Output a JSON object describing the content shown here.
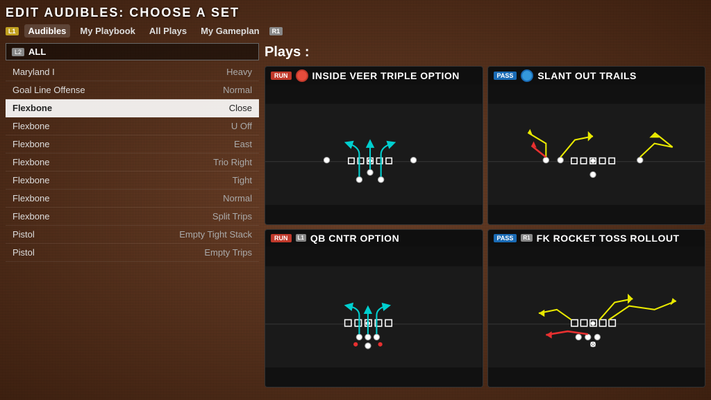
{
  "page": {
    "title": "EDIT AUDIBLES: CHOOSE A SET"
  },
  "tabs": {
    "l1_badge": "L1",
    "r1_badge": "R1",
    "items": [
      {
        "label": "Audibles",
        "active": true
      },
      {
        "label": "My Playbook",
        "active": false
      },
      {
        "label": "All Plays",
        "active": false
      },
      {
        "label": "My Gameplan",
        "active": false
      }
    ]
  },
  "filter": {
    "badge": "L2",
    "value": "ALL"
  },
  "plays_label": "Plays :",
  "formations": [
    {
      "name": "Maryland I",
      "variant": "Heavy",
      "selected": false
    },
    {
      "name": "Goal Line Offense",
      "variant": "Normal",
      "selected": false
    },
    {
      "name": "Flexbone",
      "variant": "Close",
      "selected": true
    },
    {
      "name": "Flexbone",
      "variant": "U Off",
      "selected": false
    },
    {
      "name": "Flexbone",
      "variant": "East",
      "selected": false
    },
    {
      "name": "Flexbone",
      "variant": "Trio Right",
      "selected": false
    },
    {
      "name": "Flexbone",
      "variant": "Tight",
      "selected": false
    },
    {
      "name": "Flexbone",
      "variant": "Normal",
      "selected": false
    },
    {
      "name": "Flexbone",
      "variant": "Split Trips",
      "selected": false
    },
    {
      "name": "Pistol",
      "variant": "Empty Tight Stack",
      "selected": false
    },
    {
      "name": "Pistol",
      "variant": "Empty Trips",
      "selected": false
    }
  ],
  "play_cards": [
    {
      "id": "play1",
      "type": "RUN",
      "badge": "",
      "name": "INSIDE VEER TRIPLE OPTION",
      "icon_type": "run"
    },
    {
      "id": "play2",
      "type": "PASS",
      "badge": "",
      "name": "SLANT OUT TRAILS",
      "icon_type": "pass"
    },
    {
      "id": "play3",
      "type": "RUN",
      "badge": "L1",
      "name": "QB CNTR OPTION",
      "icon_type": "run"
    },
    {
      "id": "play4",
      "type": "PASS",
      "badge": "R1",
      "name": "FK ROCKET TOSS ROLLOUT",
      "icon_type": "pass"
    }
  ]
}
